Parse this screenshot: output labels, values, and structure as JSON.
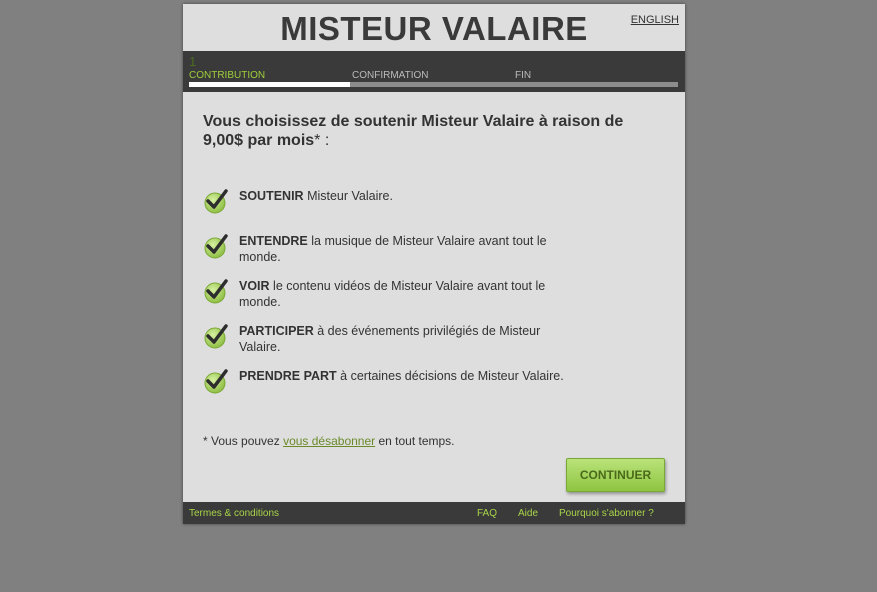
{
  "header": {
    "title": "MISTEUR VALAIRE",
    "lang_link": "ENGLISH"
  },
  "steps": {
    "current_number": "1",
    "labels": [
      "CONTRIBUTION",
      "CONFIRMATION",
      "FIN"
    ],
    "progress": 0.33
  },
  "lead": {
    "text": "Vous choisissez de soutenir Misteur Valaire à raison de 9,00$ par mois",
    "suffix": "* :"
  },
  "benefits": [
    {
      "strong": "SOUTENIR",
      "rest": " Misteur Valaire."
    },
    {
      "strong": "ENTENDRE",
      "rest": " la musique de Misteur Valaire avant tout le monde."
    },
    {
      "strong": "VOIR",
      "rest": " le contenu vidéos de Misteur Valaire avant tout le monde."
    },
    {
      "strong": "PARTICIPER",
      "rest": " à des événements privilégiés de Misteur Valaire."
    },
    {
      "strong": "PRENDRE PART",
      "rest": " à certaines décisions de Misteur Valaire."
    }
  ],
  "note": {
    "prefix": "* Vous pouvez ",
    "link": "vous désabonner",
    "suffix": " en tout temps."
  },
  "continue_label": "CONTINUER",
  "footer": {
    "terms": "Termes & conditions",
    "faq": "FAQ",
    "help": "Aide",
    "why": "Pourquoi s'abonner ?"
  },
  "colors": {
    "accent_green": "#9fcf3a",
    "button_green": "#a6d45c",
    "dark_bar": "#3a3a3a"
  }
}
